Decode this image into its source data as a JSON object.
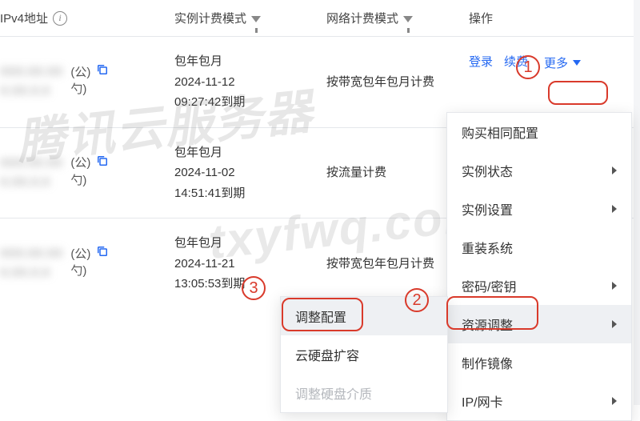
{
  "header": {
    "col_ip": "IPv4地址",
    "col_billing": "实例计费模式",
    "col_network": "网络计费模式",
    "col_actions": "操作"
  },
  "rows": [
    {
      "ip_suffix_top": "(公)",
      "ip_suffix_bot": "勺)",
      "billing_mode": "包年包月",
      "billing_date": "2024-11-12",
      "billing_expire": "09:27:42到期",
      "network": "按带宽包年包月计费"
    },
    {
      "ip_suffix_top": "(公)",
      "ip_suffix_bot": "勺)",
      "billing_mode": "包年包月",
      "billing_date": "2024-11-02",
      "billing_expire": "14:51:41到期",
      "network": "按流量计费"
    },
    {
      "ip_suffix_top": "(公)",
      "ip_suffix_bot": "勺)",
      "billing_mode": "包年包月",
      "billing_date": "2024-11-21",
      "billing_expire": "13:05:53到期",
      "network": "按带宽包年包月计费"
    }
  ],
  "actions": {
    "login": "登录",
    "renew": "续费",
    "more": "更多"
  },
  "menu": {
    "buy_same": "购买相同配置",
    "instance_state": "实例状态",
    "instance_settings": "实例设置",
    "reinstall": "重装系统",
    "pwd_key": "密码/密钥",
    "resource_adjust": "资源调整",
    "make_image": "制作镜像",
    "ip_nic": "IP/网卡"
  },
  "submenu": {
    "adjust_config": "调整配置",
    "expand_disk": "云硬盘扩容",
    "adjust_disk_medium": "调整硬盘介质"
  },
  "annotations": {
    "n1": "1",
    "n2": "2",
    "n3": "3"
  },
  "watermark": {
    "line1": "腾讯云服务器",
    "line2": "txyfwq.com"
  }
}
